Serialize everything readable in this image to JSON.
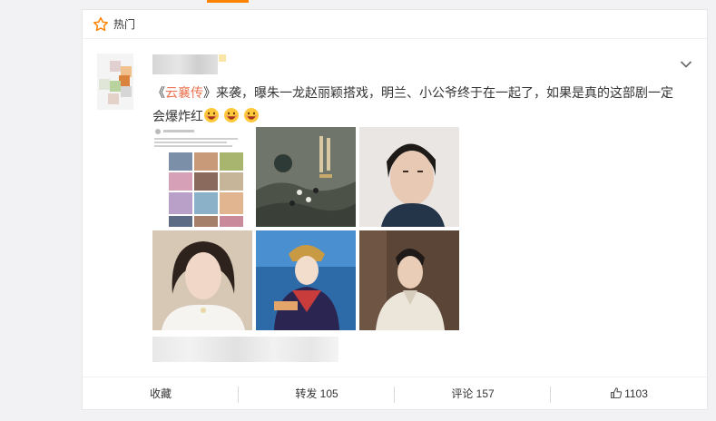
{
  "feed": {
    "hot_label": "热门",
    "hot_icon": "star-outline-icon",
    "accent_color": "#ff8200"
  },
  "post": {
    "quote_open": "《",
    "topic": "云襄传",
    "quote_close": "》",
    "text": "来袭，曝朱一龙赵丽颖搭戏，明兰、小公爷终于在一起了，如果是真的这部剧一定会爆炸红",
    "emoji": [
      "grin-icon",
      "grin-icon",
      "grin-icon"
    ],
    "images": [
      "collage-image",
      "poster-image",
      "actor-portrait-image",
      "actress-portrait-image",
      "costume-image",
      "costume-actor-image"
    ]
  },
  "actions": {
    "favorite": "收藏",
    "repost": "转发 105",
    "comment": "评论 157",
    "like": "1103"
  }
}
